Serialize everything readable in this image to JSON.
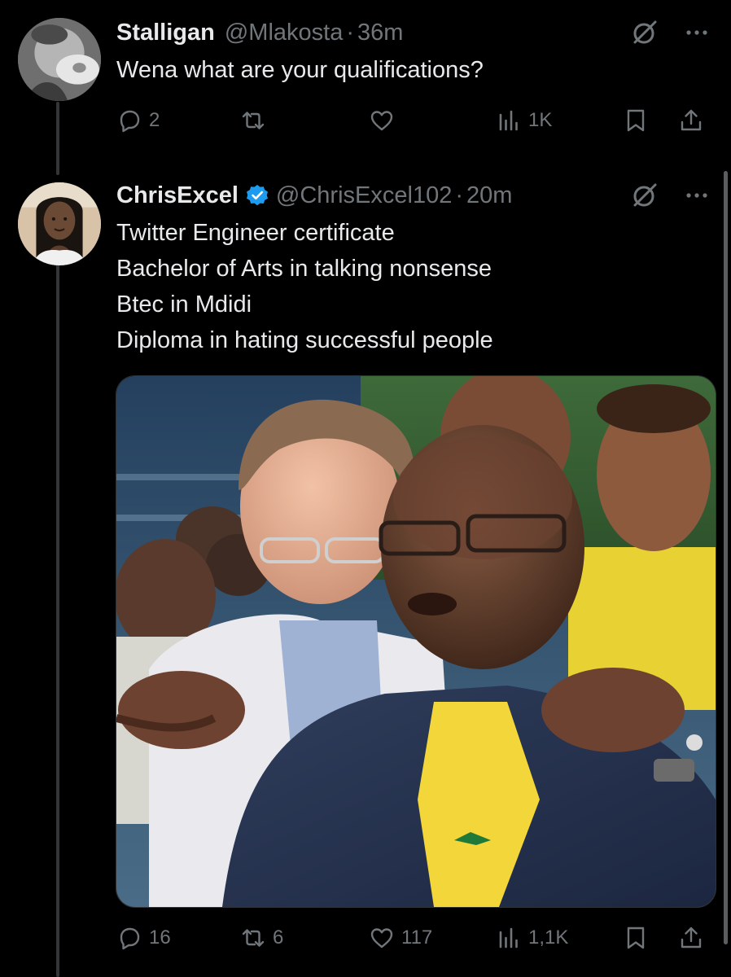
{
  "tweets": [
    {
      "author_name": "Stalligan",
      "handle": "@Mlakosta",
      "separator": "·",
      "time": "36m",
      "lines": [
        "Wena what are your qualifications?"
      ],
      "replies": "2",
      "reposts": "",
      "likes": "",
      "views": "1K"
    },
    {
      "author_name": "ChrisExcel",
      "verified": true,
      "handle": "@ChrisExcel102",
      "separator": "·",
      "time": "20m",
      "lines": [
        "Twitter Engineer certificate",
        "Bachelor of Arts in talking nonsense",
        "Btec in Mdidi",
        "Diploma in hating successful people"
      ],
      "replies": "16",
      "reposts": "6",
      "likes": "117",
      "views": "1,1K"
    }
  ],
  "icons": {
    "reply": "reply-icon",
    "repost": "repost-icon",
    "like": "heart-icon",
    "views": "views-icon",
    "bookmark": "bookmark-icon",
    "share": "share-icon",
    "grok": "grok-icon",
    "more": "more-icon",
    "verified": "verified-badge-icon"
  },
  "colors": {
    "background": "#000000",
    "text": "#e7e9ea",
    "secondary": "#71767b",
    "verified": "#1d9bf0"
  }
}
